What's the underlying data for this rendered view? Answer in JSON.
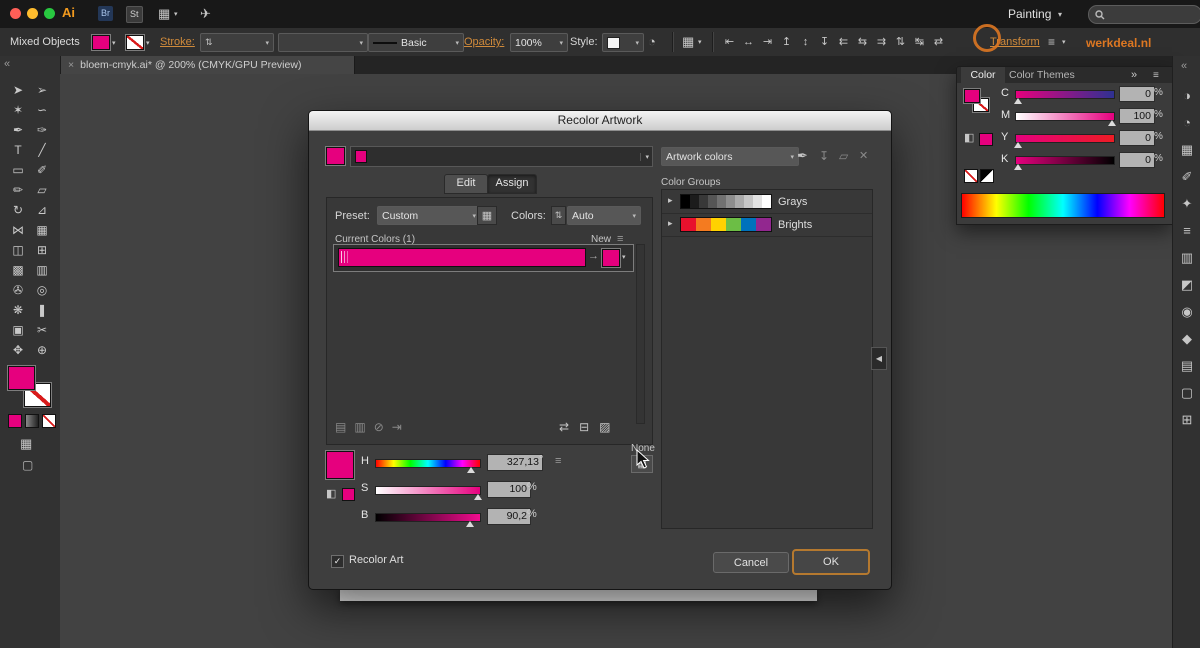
{
  "colors": {
    "magenta": "#e6007e",
    "accent": "#cf8a3b"
  },
  "icons": {
    "caret": "▾",
    "caret_up": "▴",
    "stepper": "⇅",
    "disclosure": "▸",
    "menu": "≡",
    "chevrons_left": "«",
    "chevrons_right": "»",
    "collapse_left": "◀",
    "eyedropper": "✒",
    "save": "↧",
    "folder": "▱",
    "trash": "✕",
    "arrow_right": "→",
    "check": "✓",
    "grid": "▦",
    "globe": "◔",
    "share": "✈",
    "none_grid": "▦",
    "cube": "◧",
    "close": "×"
  },
  "menubar": {
    "app_logo": "Ai",
    "bridge_badge": "Br",
    "stock_badge": "St",
    "workspace": "Painting",
    "watermark": "werkdeal.nl"
  },
  "controlbar": {
    "selection_type": "Mixed Objects",
    "stroke_label": "Stroke:",
    "brush_value": "Basic",
    "opacity_label": "Opacity:",
    "opacity_value": "100%",
    "style_label": "Style:",
    "transform_label": "Transform",
    "align_icons": [
      {
        "name": "align-left-icon",
        "glyph": "⇤"
      },
      {
        "name": "align-center-horizontal-icon",
        "glyph": "↔"
      },
      {
        "name": "align-right-icon",
        "glyph": "⇥"
      },
      {
        "name": "align-top-icon",
        "glyph": "↥"
      },
      {
        "name": "align-center-vertical-icon",
        "glyph": "↕"
      },
      {
        "name": "align-bottom-icon",
        "glyph": "↧"
      },
      {
        "name": "distribute-left-icon",
        "glyph": "⇇"
      },
      {
        "name": "distribute-center-h-icon",
        "glyph": "⇆"
      },
      {
        "name": "distribute-right-icon",
        "glyph": "⇉"
      },
      {
        "name": "distribute-top-icon",
        "glyph": "⇅"
      },
      {
        "name": "distribute-center-v-icon",
        "glyph": "↹"
      },
      {
        "name": "distribute-bottom-icon",
        "glyph": "⇄"
      }
    ]
  },
  "doc_tab": {
    "title": "bloem-cmyk.ai* @ 200% (CMYK/GPU Preview)"
  },
  "tools": [
    {
      "name": "selection-tool",
      "glyph": "➤"
    },
    {
      "name": "direct-selection-tool",
      "glyph": "➢"
    },
    {
      "name": "magic-wand-tool",
      "glyph": "✶"
    },
    {
      "name": "lasso-tool",
      "glyph": "∽"
    },
    {
      "name": "pen-tool",
      "glyph": "✒"
    },
    {
      "name": "curvature-tool",
      "glyph": "✑"
    },
    {
      "name": "type-tool",
      "glyph": "T"
    },
    {
      "name": "line-segment-tool",
      "glyph": "╱"
    },
    {
      "name": "rectangle-tool",
      "glyph": "▭"
    },
    {
      "name": "paintbrush-tool",
      "glyph": "✐"
    },
    {
      "name": "pencil-tool",
      "glyph": "✏"
    },
    {
      "name": "eraser-tool",
      "glyph": "▱"
    },
    {
      "name": "rotate-tool",
      "glyph": "↻"
    },
    {
      "name": "scale-tool",
      "glyph": "⊿"
    },
    {
      "name": "width-tool",
      "glyph": "⋈"
    },
    {
      "name": "free-transform-tool",
      "glyph": "▦"
    },
    {
      "name": "shape-builder-tool",
      "glyph": "◫"
    },
    {
      "name": "perspective-grid-tool",
      "glyph": "⊞"
    },
    {
      "name": "mesh-tool",
      "glyph": "▩"
    },
    {
      "name": "gradient-tool",
      "glyph": "▥"
    },
    {
      "name": "eyedropper-tool",
      "glyph": "✇"
    },
    {
      "name": "blend-tool",
      "glyph": "◎"
    },
    {
      "name": "symbol-sprayer-tool",
      "glyph": "❋"
    },
    {
      "name": "column-graph-tool",
      "glyph": "❚"
    },
    {
      "name": "artboard-tool",
      "glyph": "▣"
    },
    {
      "name": "slice-tool",
      "glyph": "✂"
    },
    {
      "name": "hand-tool",
      "glyph": "✥"
    },
    {
      "name": "zoom-tool",
      "glyph": "⊕"
    }
  ],
  "dialog": {
    "title": "Recolor Artwork",
    "artwork_colors": "Artwork colors",
    "tabs": {
      "edit": "Edit",
      "assign": "Assign"
    },
    "preset_label": "Preset:",
    "preset_value": "Custom",
    "colors_label": "Colors:",
    "colors_value": "Auto",
    "current_colors_label": "Current Colors (1)",
    "new_label": "New",
    "none_label": "None",
    "hsb": [
      {
        "label": "H",
        "value": "327,13",
        "unit": "°"
      },
      {
        "label": "S",
        "value": "100",
        "unit": "%"
      },
      {
        "label": "B",
        "value": "90,2",
        "unit": "%"
      }
    ],
    "recolor_art_label": "Recolor Art",
    "cancel_label": "Cancel",
    "ok_label": "OK",
    "color_groups_title": "Color Groups",
    "groups": [
      {
        "name": "Grays",
        "colors": [
          "#000000",
          "#1c1c1c",
          "#383838",
          "#555555",
          "#717171",
          "#8d8d8d",
          "#aaaaaa",
          "#c6c6c6",
          "#e2e2e2",
          "#ffffff"
        ]
      },
      {
        "name": "Brights",
        "colors": [
          "#e8112d",
          "#f47b20",
          "#ffd200",
          "#6cbe45",
          "#0072bc",
          "#92278f"
        ]
      }
    ],
    "list_icons_left": [
      {
        "name": "merge-colors-icon",
        "glyph": "▤"
      },
      {
        "name": "separate-colors-icon",
        "glyph": "▥"
      },
      {
        "name": "exclude-colors-icon",
        "glyph": "⊘"
      },
      {
        "name": "new-color-row-icon",
        "glyph": "⇥"
      }
    ],
    "list_icons_right": [
      {
        "name": "random-color-order-icon",
        "glyph": "⇄"
      },
      {
        "name": "random-saturation-icon",
        "glyph": "⊟"
      },
      {
        "name": "find-color-icon",
        "glyph": "▨"
      }
    ]
  },
  "color_panel": {
    "tab_color": "Color",
    "tab_themes": "Color Themes",
    "sliders": [
      {
        "label": "C",
        "value": "0",
        "unit": "%"
      },
      {
        "label": "M",
        "value": "100",
        "unit": "%"
      },
      {
        "label": "Y",
        "value": "0",
        "unit": "%"
      },
      {
        "label": "K",
        "value": "0",
        "unit": "%"
      }
    ]
  },
  "right_strip": [
    {
      "name": "color-panel-icon",
      "glyph": "◑"
    },
    {
      "name": "color-guide-panel-icon",
      "glyph": "◔"
    },
    {
      "name": "swatches-panel-icon",
      "glyph": "▦"
    },
    {
      "name": "brushes-panel-icon",
      "glyph": "✐"
    },
    {
      "name": "symbols-panel-icon",
      "glyph": "✦"
    },
    {
      "name": "stroke-panel-icon",
      "glyph": "≡"
    },
    {
      "name": "gradient-panel-icon",
      "glyph": "▥"
    },
    {
      "name": "transparency-panel-icon",
      "glyph": "◩"
    },
    {
      "name": "appearance-panel-icon",
      "glyph": "◉"
    },
    {
      "name": "graphic-styles-panel-icon",
      "glyph": "◆"
    },
    {
      "name": "layers-panel-icon",
      "glyph": "▤"
    },
    {
      "name": "artboards-panel-icon",
      "glyph": "▢"
    },
    {
      "name": "align-panel-icon",
      "glyph": "⊞"
    }
  ]
}
